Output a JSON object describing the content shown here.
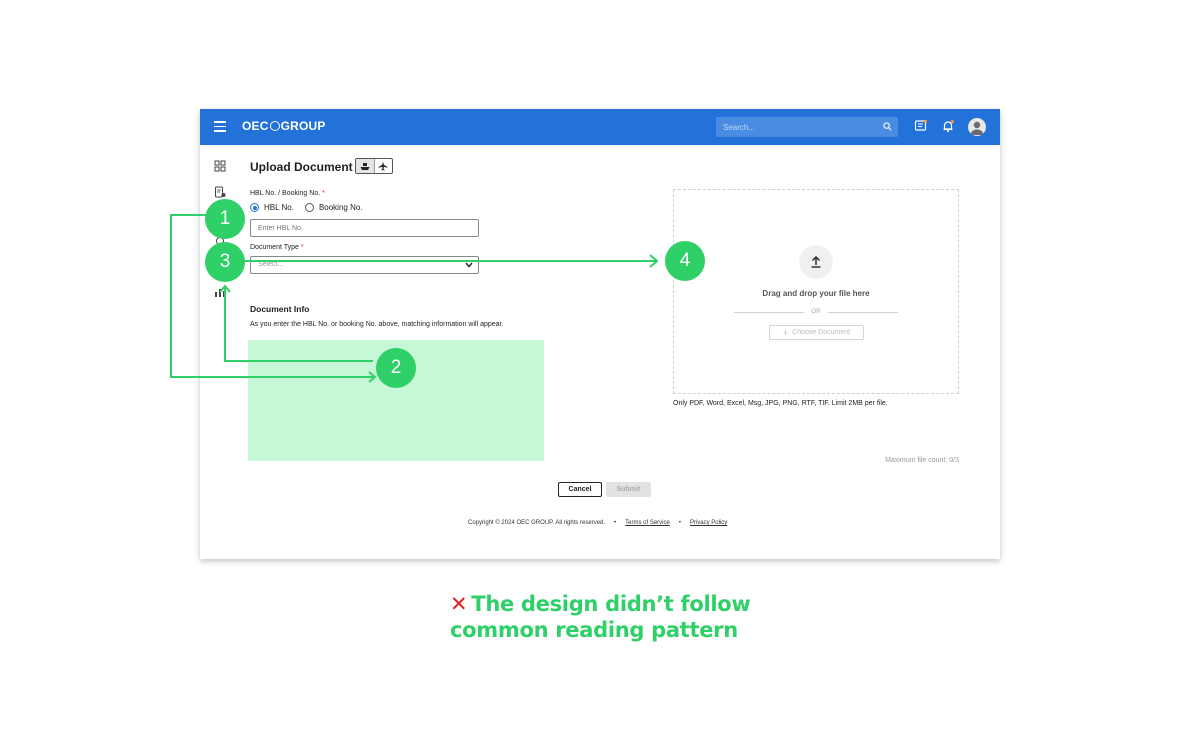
{
  "header": {
    "brand": "OEC GROUP",
    "brand_left": "OEC",
    "brand_right": "GROUP",
    "search_placeholder": "Search...",
    "color": "#2272d9"
  },
  "form": {
    "title": "Upload Document",
    "hbl_label": "HBL No. / Booking No.",
    "required_mark": "*",
    "radio_hbl": "HBL No.",
    "radio_booking": "Booking No.",
    "hbl_placeholder": "Enter HBL No.",
    "doctype_label": "Document Type",
    "doctype_placeholder": "Select...",
    "info_title": "Document Info",
    "info_text": "As you enter the HBL No. or booking No. above, matching information will appear."
  },
  "upload": {
    "drop_text": "Drag and drop your file here",
    "or_text": "OR",
    "choose_label": "Choose Document",
    "formats_text": "Only PDF, Word, Excel, Msg, JPG, PNG, RTF, TIF. Limit 2MB per file.",
    "max_count_text": "Maximum file count: 0/3"
  },
  "actions": {
    "cancel_label": "Cancel",
    "submit_label": "Submit"
  },
  "footer": {
    "copyright": "Copyright © 2024 OEC GROUP. All rights reserved.",
    "terms": "Terms of Service",
    "privacy": "Privacy Policy"
  },
  "annotations": {
    "steps": [
      "1",
      "2",
      "3",
      "4"
    ],
    "caption_line1": "The design didn’t follow",
    "caption_line2": "common reading pattern",
    "accent_color": "#2fd068",
    "error_color": "#e32020",
    "highlight_color": "#c6f8d8"
  }
}
